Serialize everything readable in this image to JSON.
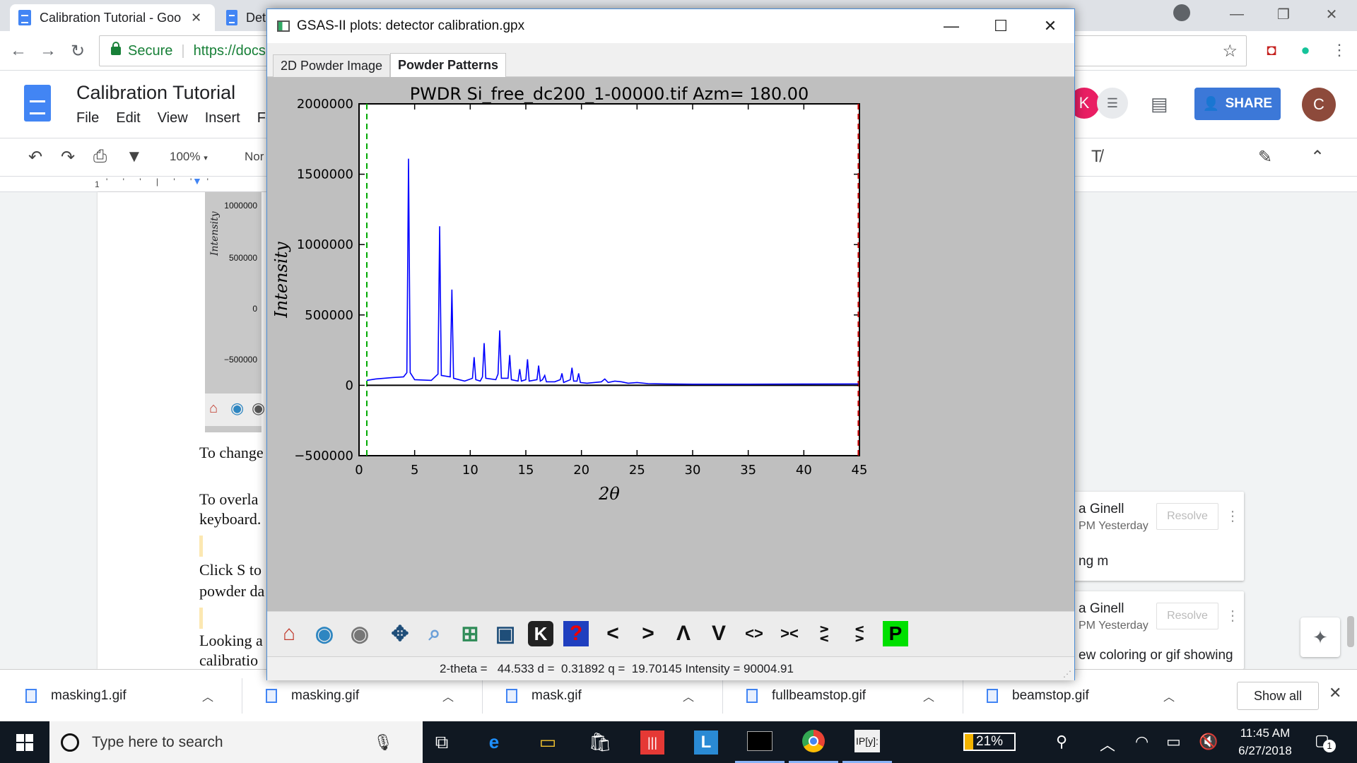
{
  "browser": {
    "tabs": [
      {
        "title": "Calibration Tutorial - Goo",
        "active": true
      },
      {
        "title": "Det",
        "active": false
      }
    ],
    "secure_label": "Secure",
    "url": "https://docs",
    "window_controls": {
      "minimize": "—",
      "restore": "❐",
      "close": "✕"
    }
  },
  "docs": {
    "title": "Calibration Tutorial",
    "menu": [
      "File",
      "Edit",
      "View",
      "Insert",
      "Fo"
    ],
    "share_label": "SHARE",
    "avatars": {
      "k": "K",
      "c": "C"
    },
    "toolbar": {
      "zoom": "100%",
      "style": "Nor"
    },
    "ruler_number": "1",
    "embedded_plot": {
      "ylabel": "Intensity",
      "ticks": [
        "1000000",
        "500000",
        "0",
        "−500000"
      ]
    },
    "body_lines": [
      "To change",
      "To overla",
      "keyboard.",
      "Click S to",
      "powder da",
      "Looking a",
      "calibratio"
    ],
    "comments": [
      {
        "name": "a Ginell",
        "time": "PM Yesterday",
        "resolve": "Resolve",
        "body": "ng m"
      },
      {
        "name": "a Ginell",
        "time": "PM Yesterday",
        "resolve": "Resolve",
        "body": "ew coloring or gif showing"
      }
    ]
  },
  "downloads": {
    "items": [
      "masking1.gif",
      "masking.gif",
      "mask.gif",
      "fullbeamstop.gif",
      "beamstop.gif"
    ],
    "show_all": "Show all"
  },
  "taskbar": {
    "search_placeholder": "Type here to search",
    "battery": "21%",
    "time": "11:45 AM",
    "date": "6/27/2018",
    "notification_count": "1"
  },
  "gsas": {
    "window_title": "GSAS-II plots: detector calibration.gpx",
    "tabs": [
      {
        "label": "2D Powder Image",
        "active": false
      },
      {
        "label": "Powder Patterns",
        "active": true
      }
    ],
    "toolbar_keys": [
      "<",
      ">",
      "Λ",
      "V",
      "<>",
      "><",
      "∧∨",
      "∨∧",
      "P",
      "K",
      "?"
    ],
    "status": "2-theta =   44.533 d =  0.31892 q =  19.70145 Intensity = 90004.91",
    "colors": {
      "line": "#0000ff",
      "baseline": "#000000",
      "limit_low": "#00aa00",
      "limit_high": "#cc0000",
      "background": "#bfbfbf"
    }
  },
  "chart_data": {
    "type": "line",
    "title": "PWDR Si_free_dc200_1-00000.tif Azm= 180.00",
    "xlabel": "2θ",
    "ylabel": "Intensity",
    "xlim": [
      0,
      45
    ],
    "ylim": [
      -500000,
      2000000
    ],
    "x_ticks": [
      0,
      5,
      10,
      15,
      20,
      25,
      30,
      35,
      40,
      45
    ],
    "y_ticks": [
      -500000,
      0,
      500000,
      1000000,
      1500000,
      2000000
    ],
    "x_tick_labels": [
      "0",
      "5",
      "10",
      "15",
      "20",
      "25",
      "30",
      "35",
      "40",
      "45"
    ],
    "y_tick_labels": [
      "−500000",
      "0",
      "500000",
      "1000000",
      "1500000",
      "2000000"
    ],
    "limits": {
      "low_2theta": 0.7,
      "high_2theta": 44.9
    },
    "series": [
      {
        "x": [
          0.7,
          1.5,
          3.0,
          4.0,
          4.3,
          4.45,
          4.6,
          5.0,
          6.5,
          7.1,
          7.25,
          7.4,
          8.2,
          8.35,
          8.5,
          9.5,
          10.2,
          10.35,
          10.5,
          10.9,
          11.1,
          11.25,
          11.4,
          12.3,
          12.5,
          12.65,
          12.8,
          13.4,
          13.55,
          13.7,
          14.3,
          14.45,
          14.6,
          15.0,
          15.15,
          15.3,
          16.0,
          16.15,
          16.3,
          16.5,
          16.7,
          16.85,
          17.6,
          18.1,
          18.25,
          18.4,
          19.0,
          19.15,
          19.3,
          19.6,
          19.75,
          19.9,
          20.5,
          21.8,
          22.1,
          22.4,
          23.0,
          23.6,
          24.2,
          25.0,
          26.0,
          27.5,
          30.0,
          35.0,
          40.0,
          44.9
        ],
        "y": [
          35000,
          45000,
          55000,
          60000,
          90000,
          1610000,
          90000,
          40000,
          35000,
          80000,
          1130000,
          70000,
          60000,
          680000,
          50000,
          30000,
          50000,
          200000,
          40000,
          30000,
          60000,
          300000,
          50000,
          40000,
          80000,
          390000,
          50000,
          50000,
          215000,
          40000,
          30000,
          115000,
          30000,
          40000,
          185000,
          30000,
          40000,
          140000,
          30000,
          40000,
          70000,
          25000,
          25000,
          40000,
          85000,
          20000,
          40000,
          125000,
          30000,
          30000,
          85000,
          20000,
          15000,
          25000,
          45000,
          20000,
          30000,
          25000,
          15000,
          20000,
          12000,
          10000,
          8000,
          8000,
          9000,
          10000
        ]
      },
      {
        "x": [
          0.7,
          44.9
        ],
        "y": [
          0,
          0
        ]
      }
    ]
  }
}
